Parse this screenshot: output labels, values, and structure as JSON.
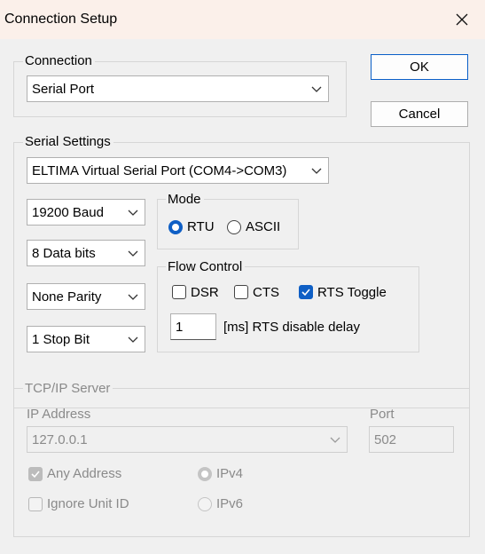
{
  "window": {
    "title": "Connection Setup"
  },
  "buttons": {
    "ok": "OK",
    "cancel": "Cancel"
  },
  "connection": {
    "label": "Connection",
    "value": "Serial Port"
  },
  "serial": {
    "label": "Serial Settings",
    "port": "ELTIMA Virtual Serial Port (COM4->COM3)",
    "baud": "19200 Baud",
    "data_bits": "8 Data bits",
    "parity": "None Parity",
    "stop_bits": "1 Stop Bit",
    "mode": {
      "label": "Mode",
      "rtu": "RTU",
      "ascii": "ASCII",
      "selected": "RTU"
    },
    "flow": {
      "label": "Flow Control",
      "dsr": "DSR",
      "dsr_checked": false,
      "cts": "CTS",
      "cts_checked": false,
      "rts_toggle": "RTS Toggle",
      "rts_toggle_checked": true,
      "delay_value": "1",
      "delay_label": "[ms] RTS disable delay"
    }
  },
  "tcp": {
    "label": "TCP/IP Server",
    "ip_label": "IP Address",
    "ip_value": "127.0.0.1",
    "port_label": "Port",
    "port_value": "502",
    "any_address": "Any Address",
    "any_address_checked": true,
    "ignore_unit": "Ignore Unit ID",
    "ignore_unit_checked": false,
    "ipv4": "IPv4",
    "ipv6": "IPv6",
    "ip_version_selected": "IPv4"
  },
  "colors": {
    "accent": "#0f5fc5",
    "titlebar": "#fbf0ea",
    "dialog_bg": "#f0f0f0"
  }
}
